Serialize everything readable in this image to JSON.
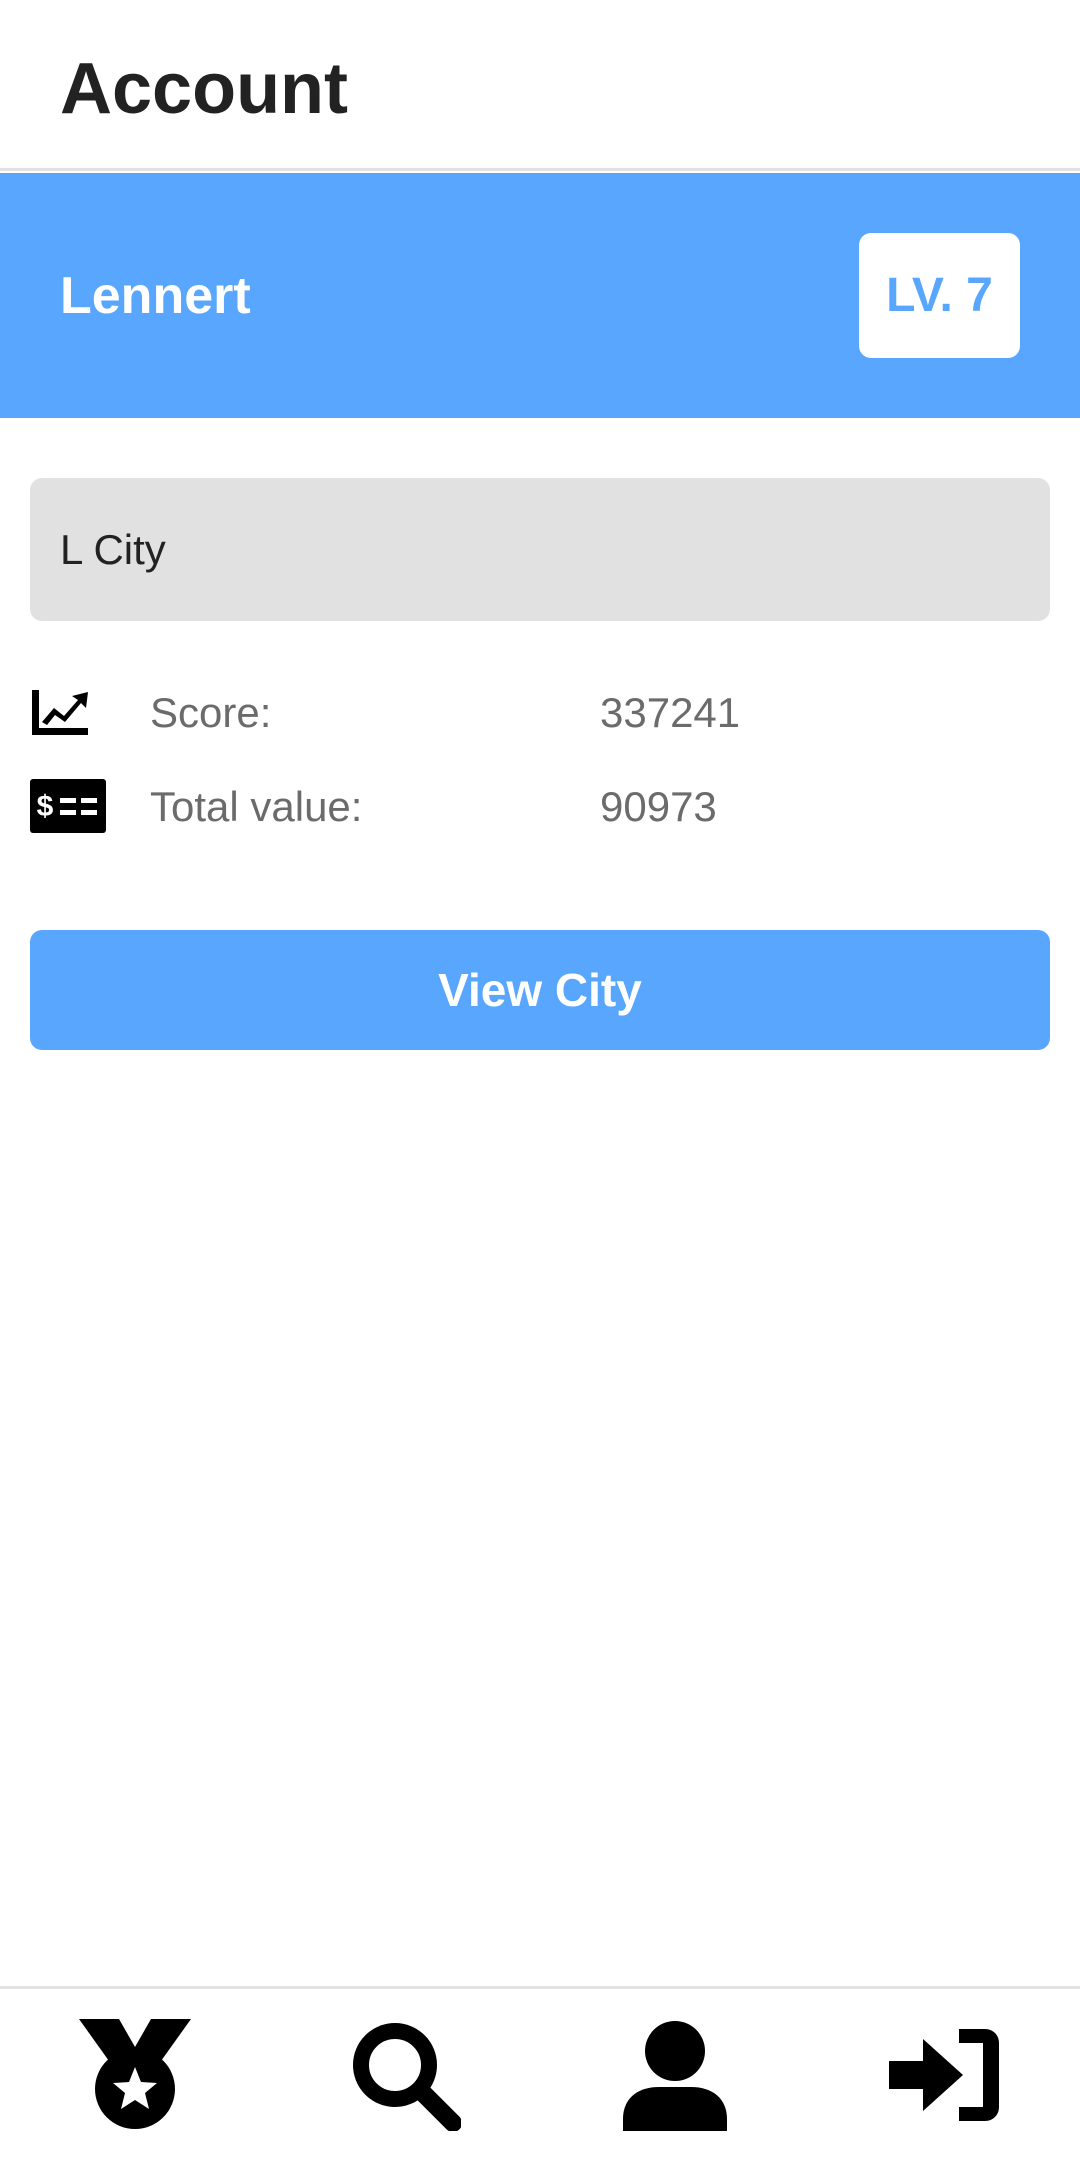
{
  "header": {
    "title": "Account"
  },
  "user": {
    "name": "Lennert",
    "level_label": "LV. 7"
  },
  "city": {
    "name": "L City"
  },
  "stats": [
    {
      "label": "Score:",
      "value": "337241",
      "icon": "chart-line-icon"
    },
    {
      "label": "Total value:",
      "value": "90973",
      "icon": "money-check-icon"
    }
  ],
  "actions": {
    "view_city_label": "View City"
  },
  "bottom_nav": [
    {
      "icon": "medal-icon"
    },
    {
      "icon": "search-icon"
    },
    {
      "icon": "user-icon"
    },
    {
      "icon": "sign-in-icon"
    }
  ],
  "colors": {
    "accent": "#58a6fd",
    "title_text": "#222222",
    "muted_text": "#6b6b6b",
    "input_bg": "#e1e1e1"
  }
}
